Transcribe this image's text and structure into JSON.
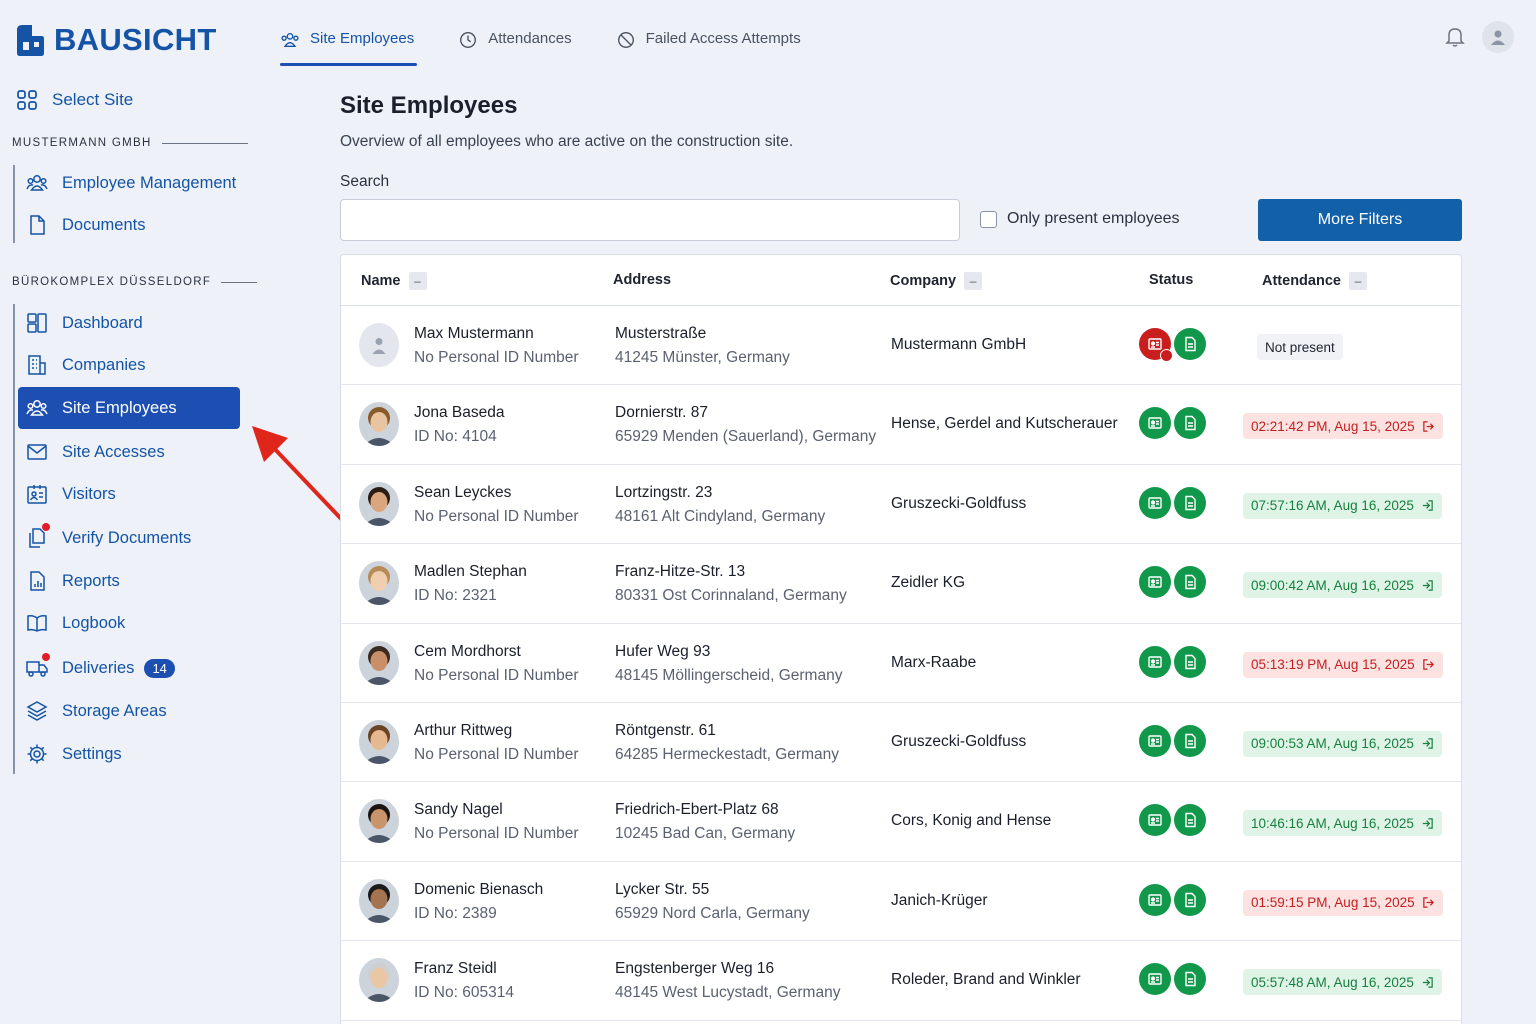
{
  "brand": {
    "name": "BAUSICHT"
  },
  "sidebar": {
    "select_site": "Select Site",
    "groups": [
      {
        "title": "MUSTERMANN GMBH",
        "items": [
          {
            "label": "Employee Management",
            "icon": "people-icon"
          },
          {
            "label": "Documents",
            "icon": "document-icon"
          }
        ]
      },
      {
        "title": "BÜROKOMPLEX DÜSSELDORF",
        "items": [
          {
            "label": "Dashboard",
            "icon": "dashboard-icon"
          },
          {
            "label": "Companies",
            "icon": "building-icon"
          },
          {
            "label": "Site Employees",
            "icon": "people-icon",
            "active": true
          },
          {
            "label": "Site Accesses",
            "icon": "envelope-icon"
          },
          {
            "label": "Visitors",
            "icon": "visitor-badge-icon"
          },
          {
            "label": "Verify Documents",
            "icon": "documents-icon",
            "dot": true
          },
          {
            "label": "Reports",
            "icon": "report-icon"
          },
          {
            "label": "Logbook",
            "icon": "book-icon"
          },
          {
            "label": "Deliveries",
            "icon": "truck-icon",
            "dot": true,
            "badge": "14"
          },
          {
            "label": "Storage Areas",
            "icon": "layers-icon"
          },
          {
            "label": "Settings",
            "icon": "gear-icon"
          }
        ]
      }
    ]
  },
  "tabs": [
    {
      "label": "Site Employees",
      "icon": "people-icon",
      "active": true
    },
    {
      "label": "Attendances",
      "icon": "clock-icon"
    },
    {
      "label": "Failed Access Attempts",
      "icon": "blocked-icon"
    }
  ],
  "header": {
    "bell_icon": "bell-icon",
    "user_icon": "user-avatar-icon"
  },
  "main": {
    "title": "Site Employees",
    "subtitle": "Overview of all employees who are active on the construction site.",
    "search_label": "Search",
    "search_value": "",
    "only_present_label": "Only present employees",
    "only_present_checked": false,
    "more_filters_label": "More Filters"
  },
  "table": {
    "columns": {
      "name": "Name",
      "address": "Address",
      "company": "Company",
      "status": "Status",
      "attendance": "Attendance"
    },
    "rows": [
      {
        "name": "Max Mustermann",
        "id": "No Personal ID Number",
        "street": "Musterstraße",
        "city": "41245 Münster, Germany",
        "company": "Mustermann GmbH",
        "badge_status": "red",
        "doc_status": "green",
        "attendance": "Not present",
        "att_type": "none",
        "avatar": "placeholder"
      },
      {
        "name": "Jona Baseda",
        "id": "ID No: 4104",
        "street": "Dornierstr. 87",
        "city": "65929 Menden (Sauerland), Germany",
        "company": "Hense, Gerdel and Kutscherauer",
        "badge_status": "green",
        "doc_status": "green",
        "attendance": "02:21:42 PM, Aug 15, 2025",
        "att_type": "out",
        "avatar": "photo"
      },
      {
        "name": "Sean Leyckes",
        "id": "No Personal ID Number",
        "street": "Lortzingstr. 23",
        "city": "48161 Alt Cindyland, Germany",
        "company": "Gruszecki-Goldfuss",
        "badge_status": "green",
        "doc_status": "green",
        "attendance": "07:57:16 AM, Aug 16, 2025",
        "att_type": "in",
        "avatar": "photo"
      },
      {
        "name": "Madlen Stephan",
        "id": "ID No: 2321",
        "street": "Franz-Hitze-Str. 13",
        "city": "80331 Ost Corinnaland, Germany",
        "company": "Zeidler KG",
        "badge_status": "green",
        "doc_status": "green",
        "attendance": "09:00:42 AM, Aug 16, 2025",
        "att_type": "in",
        "avatar": "photo"
      },
      {
        "name": "Cem Mordhorst",
        "id": "No Personal ID Number",
        "street": "Hufer Weg 93",
        "city": "48145 Möllingerscheid, Germany",
        "company": "Marx-Raabe",
        "badge_status": "green",
        "doc_status": "green",
        "attendance": "05:13:19 PM, Aug 15, 2025",
        "att_type": "out",
        "avatar": "photo"
      },
      {
        "name": "Arthur Rittweg",
        "id": "No Personal ID Number",
        "street": "Röntgenstr. 61",
        "city": "64285 Hermeckestadt, Germany",
        "company": "Gruszecki-Goldfuss",
        "badge_status": "green",
        "doc_status": "green",
        "attendance": "09:00:53 AM, Aug 16, 2025",
        "att_type": "in",
        "avatar": "photo"
      },
      {
        "name": "Sandy Nagel",
        "id": "No Personal ID Number",
        "street": "Friedrich-Ebert-Platz 68",
        "city": "10245 Bad Can, Germany",
        "company": "Cors, Konig and Hense",
        "badge_status": "green",
        "doc_status": "green",
        "attendance": "10:46:16 AM, Aug 16, 2025",
        "att_type": "in",
        "avatar": "photo"
      },
      {
        "name": "Domenic Bienasch",
        "id": "ID No: 2389",
        "street": "Lycker Str. 55",
        "city": "65929 Nord Carla, Germany",
        "company": "Janich-Krüger",
        "badge_status": "green",
        "doc_status": "green",
        "attendance": "01:59:15 PM, Aug 15, 2025",
        "att_type": "out",
        "avatar": "photo"
      },
      {
        "name": "Franz Steidl",
        "id": "ID No: 605314",
        "street": "Engstenberger Weg 16",
        "city": "48145 West Lucystadt, Germany",
        "company": "Roleder, Brand and Winkler",
        "badge_status": "green",
        "doc_status": "green",
        "attendance": "05:57:48 AM, Aug 16, 2025",
        "att_type": "in",
        "avatar": "photo"
      }
    ]
  },
  "colors": {
    "brand": "#1453a6",
    "active_nav": "#1d4fb3",
    "button": "#1260a8",
    "status_green": "#11984a",
    "status_red": "#c81e1e",
    "arrow": "#e0251b"
  }
}
